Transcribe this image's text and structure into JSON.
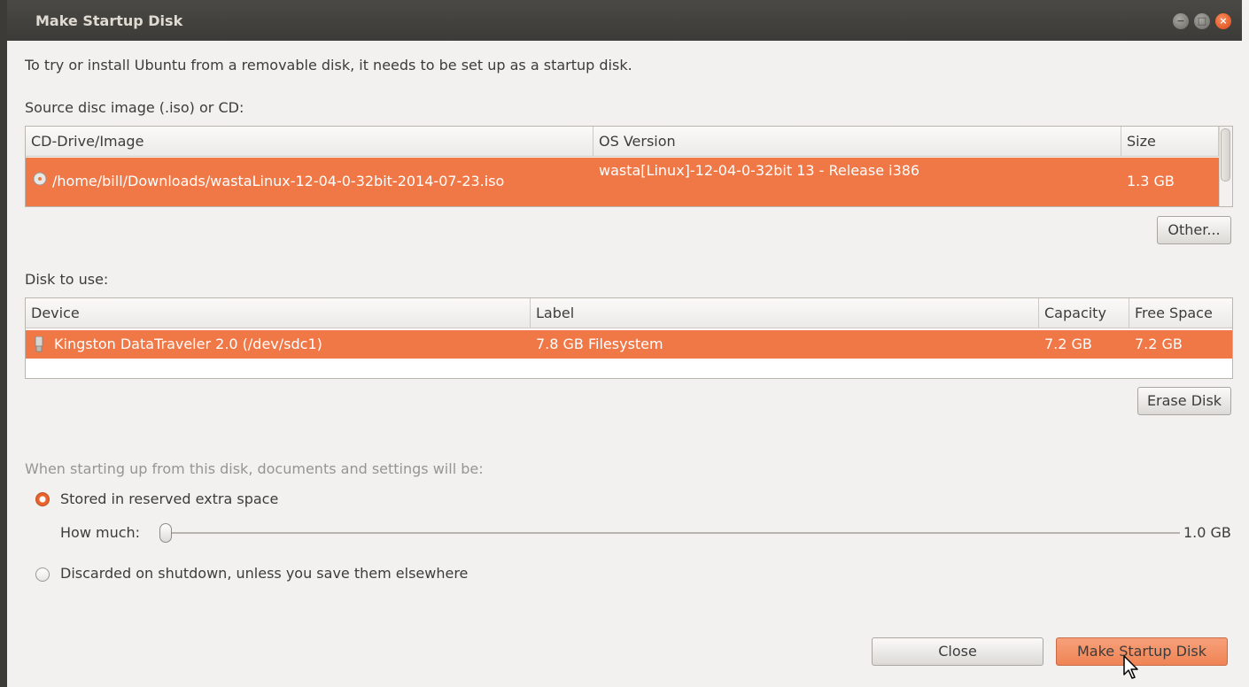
{
  "window": {
    "title": "Make Startup Disk",
    "buttons": {
      "minimize": "−",
      "maximize": "□",
      "close": "×"
    }
  },
  "intro_text": "To try or install Ubuntu from a removable disk, it needs to be set up as a startup disk.",
  "source": {
    "label": "Source disc image (.iso) or CD:",
    "columns": [
      "CD-Drive/Image",
      "OS Version",
      "Size"
    ],
    "rows": [
      {
        "icon": "disc-icon",
        "image": "/home/bill/Downloads/wastaLinux-12-04-0-32bit-2014-07-23.iso",
        "os_version": "wasta[Linux]-12-04-0-32bit 13 - Release i386",
        "size": "1.3 GB",
        "selected": true
      }
    ],
    "other_button": "Other..."
  },
  "disk": {
    "label": "Disk to use:",
    "columns": [
      "Device",
      "Label",
      "Capacity",
      "Free Space"
    ],
    "rows": [
      {
        "icon": "usb-drive-icon",
        "device": "Kingston DataTraveler 2.0 (/dev/sdc1)",
        "label": "7.8 GB Filesystem",
        "capacity": "7.2 GB",
        "free_space": "7.2 GB",
        "selected": true
      }
    ],
    "erase_button": "Erase Disk"
  },
  "persistence": {
    "heading": "When starting up from this disk, documents and settings will be:",
    "option_stored": "Stored in reserved extra space",
    "option_discarded": "Discarded on shutdown, unless you save them elsewhere",
    "selected_option": "stored",
    "how_much_label": "How much:",
    "how_much_value": "1.0 GB",
    "slider_fraction": 0.0
  },
  "footer": {
    "close_button": "Close",
    "make_button": "Make Startup Disk"
  },
  "colors": {
    "selection": "#f07746",
    "accent_radio": "#e8622e",
    "titlebar": "#3c3b37",
    "window_bg": "#f2f1f0"
  }
}
